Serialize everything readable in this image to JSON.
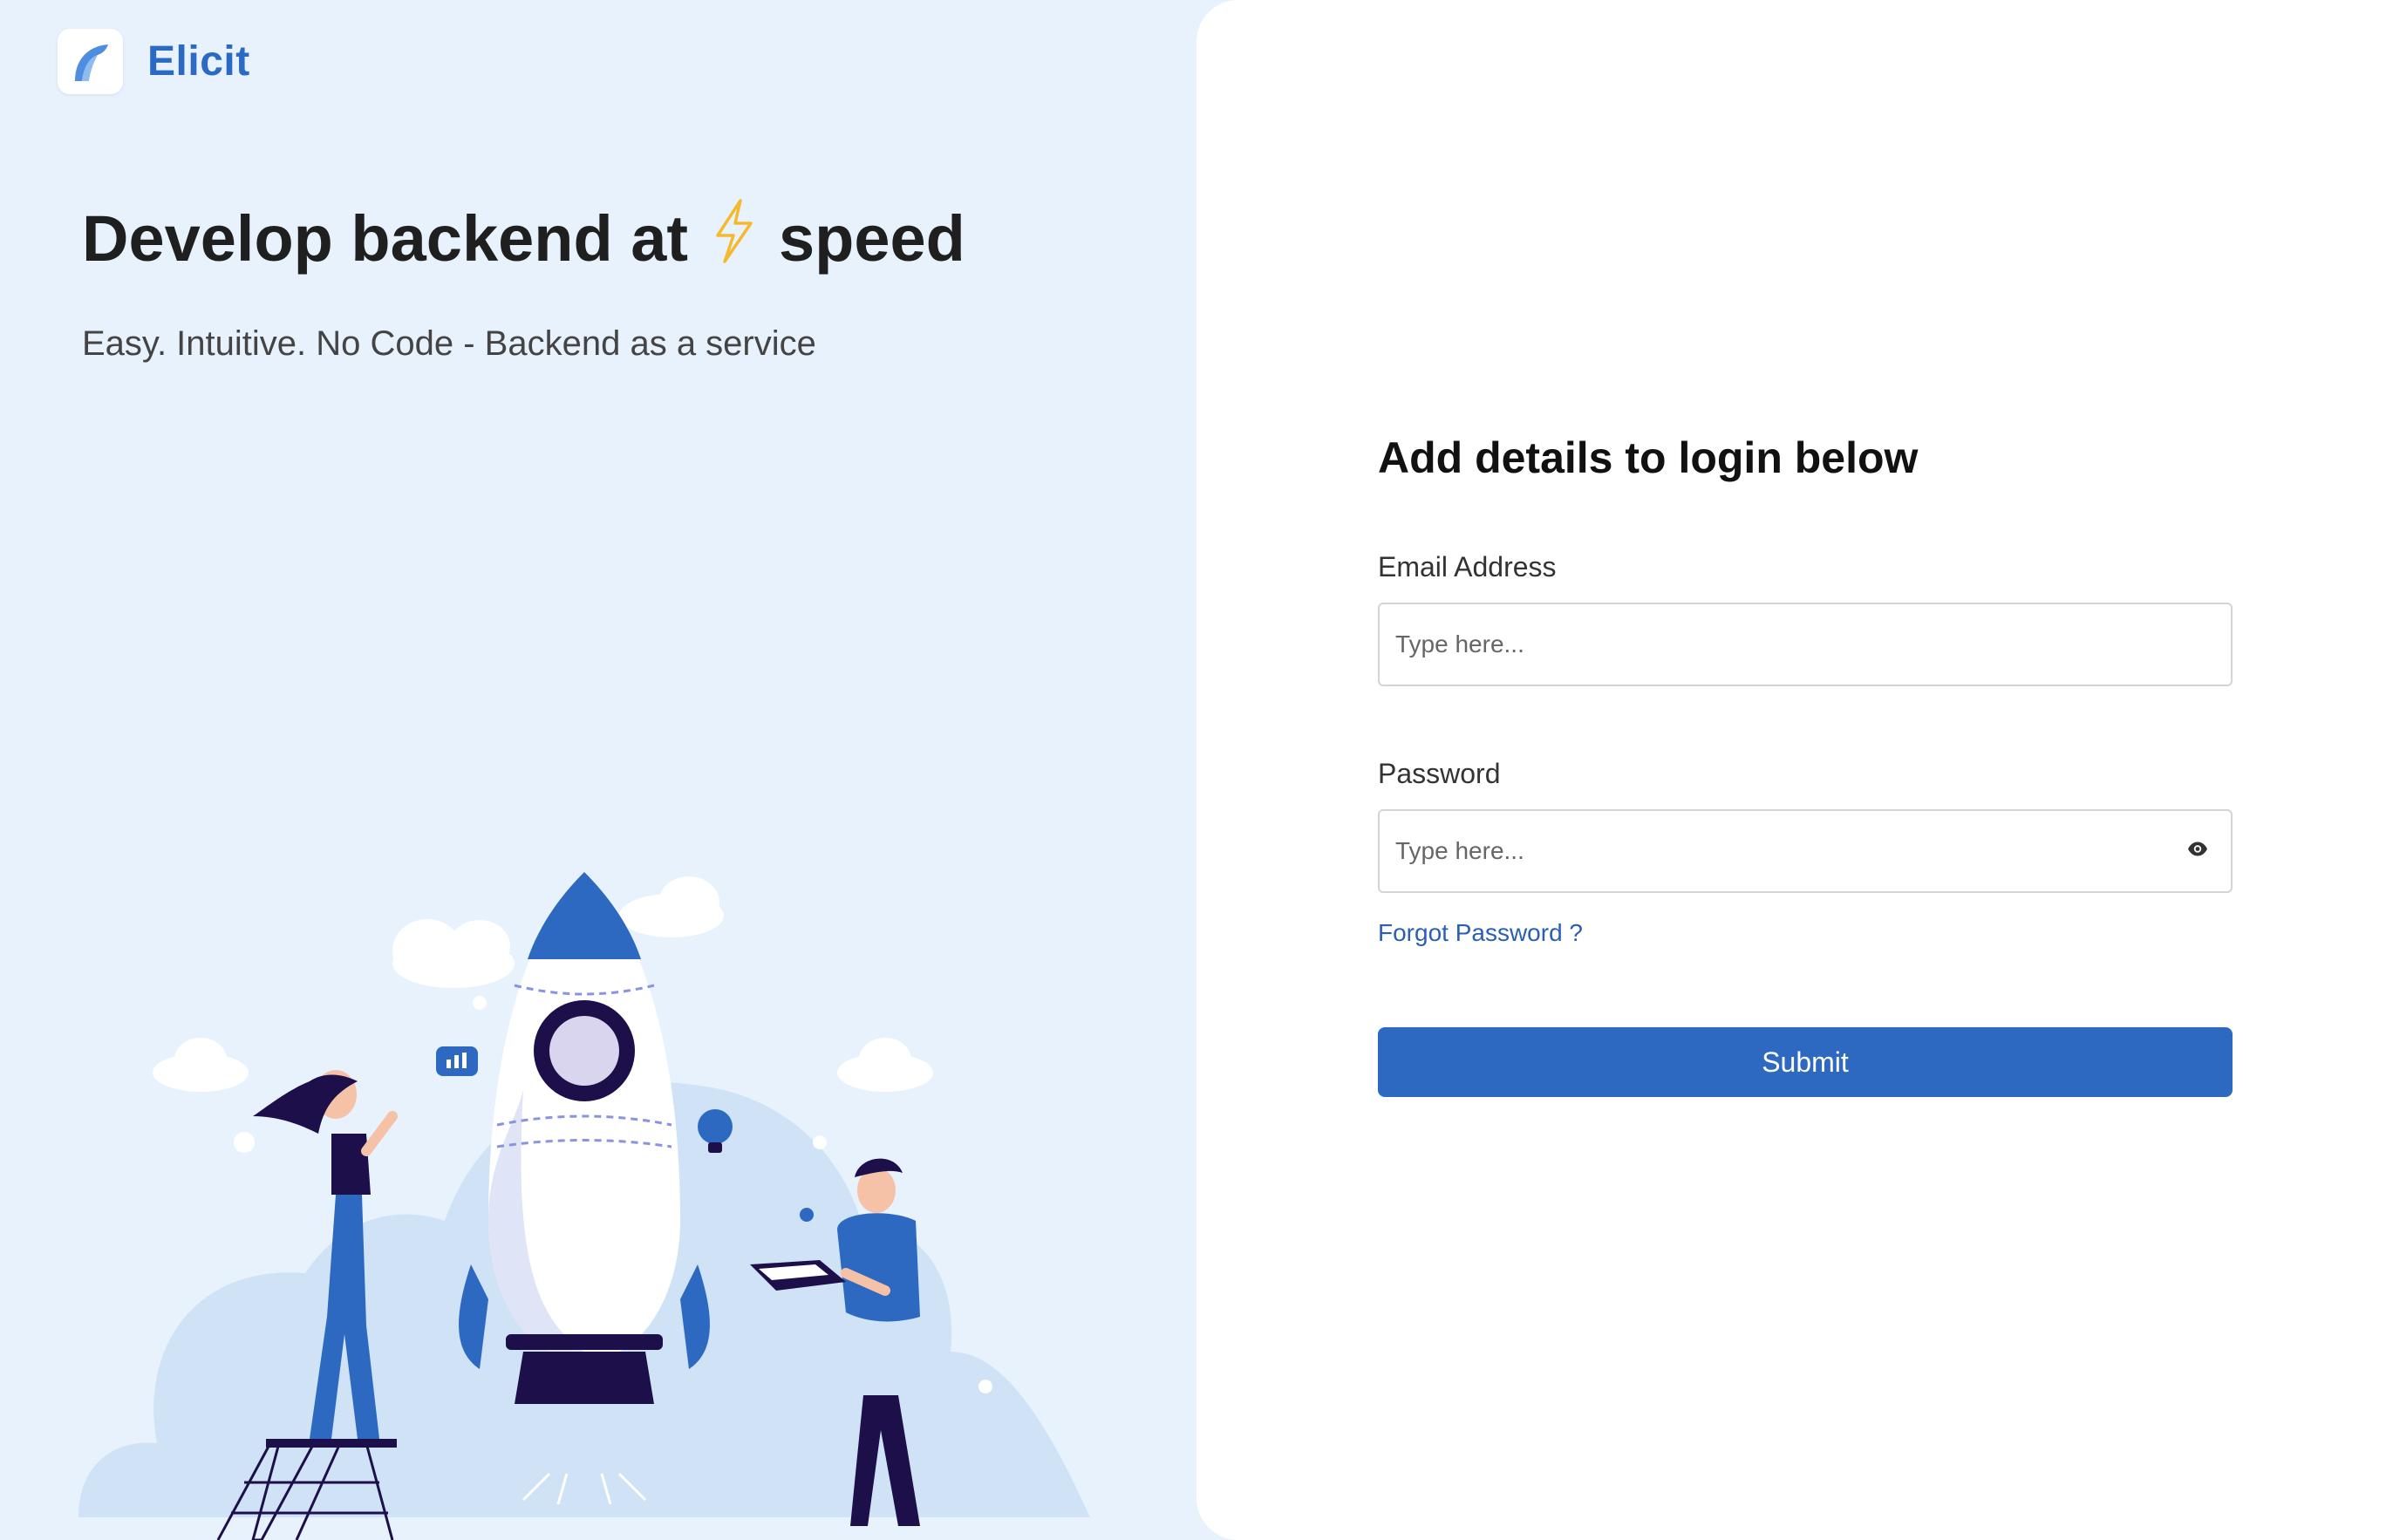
{
  "brand": {
    "name": "Elicit",
    "logo_icon": "feather-leaf-icon",
    "color": "#2a6ac4"
  },
  "hero": {
    "headline_before": "Develop backend at",
    "headline_icon": "lightning-bolt-icon",
    "headline_after": "speed",
    "subline": "Easy. Intuitive. No Code - Backend as a service"
  },
  "login": {
    "title": "Add details to login below",
    "email": {
      "label": "Email Address",
      "placeholder": "Type here...",
      "value": ""
    },
    "password": {
      "label": "Password",
      "placeholder": "Type here...",
      "value": "",
      "toggle_icon": "eye-icon"
    },
    "forgot_link": "Forgot Password ?",
    "submit_label": "Submit"
  },
  "colors": {
    "left_background": "#e8f2fd",
    "accent": "#2d69c1",
    "link": "#2a5fb4",
    "bolt": "#f5b92e"
  },
  "illustration": {
    "name": "rocket-launch-illustration"
  }
}
